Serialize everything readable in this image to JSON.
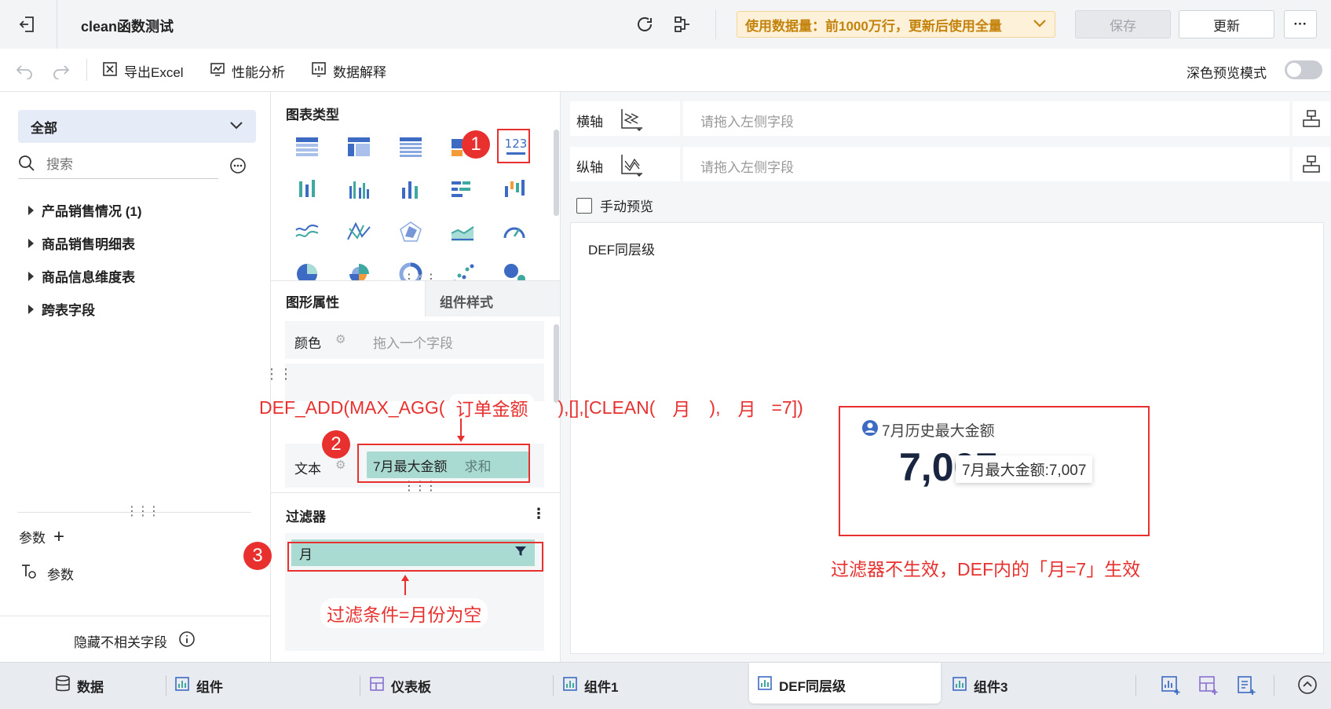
{
  "header": {
    "title": "clean函数测试",
    "data_usage": "使用数据量：前1000万行，更新后使用全量",
    "save_label": "保存",
    "update_label": "更新",
    "more_label": "···"
  },
  "toolbar": {
    "export_label": "导出Excel",
    "perf_label": "性能分析",
    "explain_label": "数据解释",
    "dark_mode_label": "深色预览模式"
  },
  "left": {
    "dropdown_value": "全部",
    "search_placeholder": "搜索",
    "tree": [
      "产品销售情况 (1)",
      "商品销售明细表",
      "商品信息维度表",
      "跨表字段"
    ],
    "params_label": "参数",
    "param_item": "参数",
    "hide_label": "隐藏不相关字段"
  },
  "mid": {
    "chart_type_label": "图表类型",
    "tab_props": "图形属性",
    "tab_style": "组件样式",
    "color_label": "颜色",
    "color_placeholder": "拖入一个字段",
    "text_label": "文本",
    "field_name": "7月最大金额",
    "field_agg": "求和",
    "filter_label": "过滤器",
    "filter_field": "月"
  },
  "right": {
    "x_axis_label": "横轴",
    "y_axis_label": "纵轴",
    "axis_placeholder": "请拖入左侧字段",
    "manual_preview_label": "手动预览",
    "canvas_title": "DEF同层级",
    "kpi_title": "7月历史最大金额",
    "kpi_value": "7,007",
    "tooltip": "7月最大金额:7,007"
  },
  "annotations": {
    "badge1": "1",
    "badge2": "2",
    "badge3": "3",
    "formula_p1": "DEF_ADD(MAX_AGG(",
    "formula_p2": "订单金额",
    "formula_p3": "),[],[CLEAN(",
    "formula_p4": "月",
    "formula_p5": "),",
    "formula_p6": "月",
    "formula_p7": "=7])",
    "filter_note": "过滤条件=月份为空",
    "result_note": "过滤器不生效，DEF内的「月=7」生效"
  },
  "bottom_tabs": [
    "数据",
    "组件",
    "仪表板",
    "组件1",
    "DEF同层级",
    "组件3"
  ],
  "colors": {
    "accent": "#2f6fed",
    "teal": "#a9dbd3",
    "red": "#e8312f",
    "warn_bg": "#fdf1d9"
  }
}
